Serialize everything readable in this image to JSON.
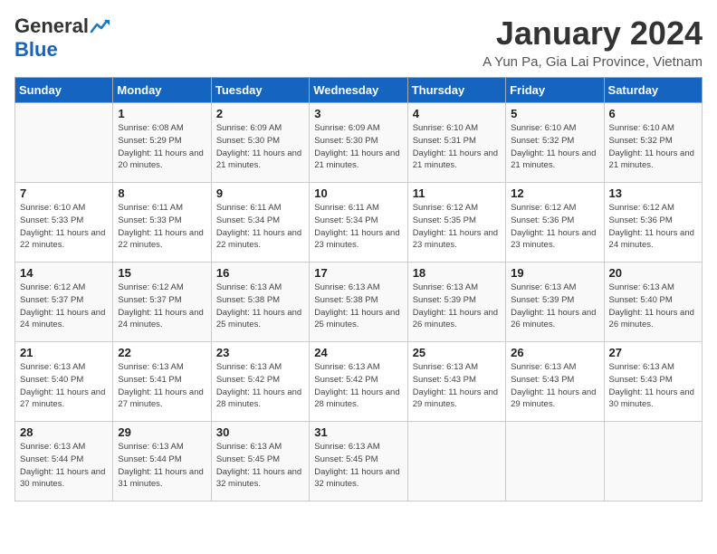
{
  "logo": {
    "general": "General",
    "blue": "Blue"
  },
  "title": "January 2024",
  "subtitle": "A Yun Pa, Gia Lai Province, Vietnam",
  "days": [
    "Sunday",
    "Monday",
    "Tuesday",
    "Wednesday",
    "Thursday",
    "Friday",
    "Saturday"
  ],
  "weeks": [
    [
      {
        "num": "",
        "sunrise": "",
        "sunset": "",
        "daylight": ""
      },
      {
        "num": "1",
        "sunrise": "6:08 AM",
        "sunset": "5:29 PM",
        "daylight": "11 hours and 20 minutes."
      },
      {
        "num": "2",
        "sunrise": "6:09 AM",
        "sunset": "5:30 PM",
        "daylight": "11 hours and 21 minutes."
      },
      {
        "num": "3",
        "sunrise": "6:09 AM",
        "sunset": "5:30 PM",
        "daylight": "11 hours and 21 minutes."
      },
      {
        "num": "4",
        "sunrise": "6:10 AM",
        "sunset": "5:31 PM",
        "daylight": "11 hours and 21 minutes."
      },
      {
        "num": "5",
        "sunrise": "6:10 AM",
        "sunset": "5:32 PM",
        "daylight": "11 hours and 21 minutes."
      },
      {
        "num": "6",
        "sunrise": "6:10 AM",
        "sunset": "5:32 PM",
        "daylight": "11 hours and 21 minutes."
      }
    ],
    [
      {
        "num": "7",
        "sunrise": "6:10 AM",
        "sunset": "5:33 PM",
        "daylight": "11 hours and 22 minutes."
      },
      {
        "num": "8",
        "sunrise": "6:11 AM",
        "sunset": "5:33 PM",
        "daylight": "11 hours and 22 minutes."
      },
      {
        "num": "9",
        "sunrise": "6:11 AM",
        "sunset": "5:34 PM",
        "daylight": "11 hours and 22 minutes."
      },
      {
        "num": "10",
        "sunrise": "6:11 AM",
        "sunset": "5:34 PM",
        "daylight": "11 hours and 23 minutes."
      },
      {
        "num": "11",
        "sunrise": "6:12 AM",
        "sunset": "5:35 PM",
        "daylight": "11 hours and 23 minutes."
      },
      {
        "num": "12",
        "sunrise": "6:12 AM",
        "sunset": "5:36 PM",
        "daylight": "11 hours and 23 minutes."
      },
      {
        "num": "13",
        "sunrise": "6:12 AM",
        "sunset": "5:36 PM",
        "daylight": "11 hours and 24 minutes."
      }
    ],
    [
      {
        "num": "14",
        "sunrise": "6:12 AM",
        "sunset": "5:37 PM",
        "daylight": "11 hours and 24 minutes."
      },
      {
        "num": "15",
        "sunrise": "6:12 AM",
        "sunset": "5:37 PM",
        "daylight": "11 hours and 24 minutes."
      },
      {
        "num": "16",
        "sunrise": "6:13 AM",
        "sunset": "5:38 PM",
        "daylight": "11 hours and 25 minutes."
      },
      {
        "num": "17",
        "sunrise": "6:13 AM",
        "sunset": "5:38 PM",
        "daylight": "11 hours and 25 minutes."
      },
      {
        "num": "18",
        "sunrise": "6:13 AM",
        "sunset": "5:39 PM",
        "daylight": "11 hours and 26 minutes."
      },
      {
        "num": "19",
        "sunrise": "6:13 AM",
        "sunset": "5:39 PM",
        "daylight": "11 hours and 26 minutes."
      },
      {
        "num": "20",
        "sunrise": "6:13 AM",
        "sunset": "5:40 PM",
        "daylight": "11 hours and 26 minutes."
      }
    ],
    [
      {
        "num": "21",
        "sunrise": "6:13 AM",
        "sunset": "5:40 PM",
        "daylight": "11 hours and 27 minutes."
      },
      {
        "num": "22",
        "sunrise": "6:13 AM",
        "sunset": "5:41 PM",
        "daylight": "11 hours and 27 minutes."
      },
      {
        "num": "23",
        "sunrise": "6:13 AM",
        "sunset": "5:42 PM",
        "daylight": "11 hours and 28 minutes."
      },
      {
        "num": "24",
        "sunrise": "6:13 AM",
        "sunset": "5:42 PM",
        "daylight": "11 hours and 28 minutes."
      },
      {
        "num": "25",
        "sunrise": "6:13 AM",
        "sunset": "5:43 PM",
        "daylight": "11 hours and 29 minutes."
      },
      {
        "num": "26",
        "sunrise": "6:13 AM",
        "sunset": "5:43 PM",
        "daylight": "11 hours and 29 minutes."
      },
      {
        "num": "27",
        "sunrise": "6:13 AM",
        "sunset": "5:43 PM",
        "daylight": "11 hours and 30 minutes."
      }
    ],
    [
      {
        "num": "28",
        "sunrise": "6:13 AM",
        "sunset": "5:44 PM",
        "daylight": "11 hours and 30 minutes."
      },
      {
        "num": "29",
        "sunrise": "6:13 AM",
        "sunset": "5:44 PM",
        "daylight": "11 hours and 31 minutes."
      },
      {
        "num": "30",
        "sunrise": "6:13 AM",
        "sunset": "5:45 PM",
        "daylight": "11 hours and 32 minutes."
      },
      {
        "num": "31",
        "sunrise": "6:13 AM",
        "sunset": "5:45 PM",
        "daylight": "11 hours and 32 minutes."
      },
      {
        "num": "",
        "sunrise": "",
        "sunset": "",
        "daylight": ""
      },
      {
        "num": "",
        "sunrise": "",
        "sunset": "",
        "daylight": ""
      },
      {
        "num": "",
        "sunrise": "",
        "sunset": "",
        "daylight": ""
      }
    ]
  ]
}
